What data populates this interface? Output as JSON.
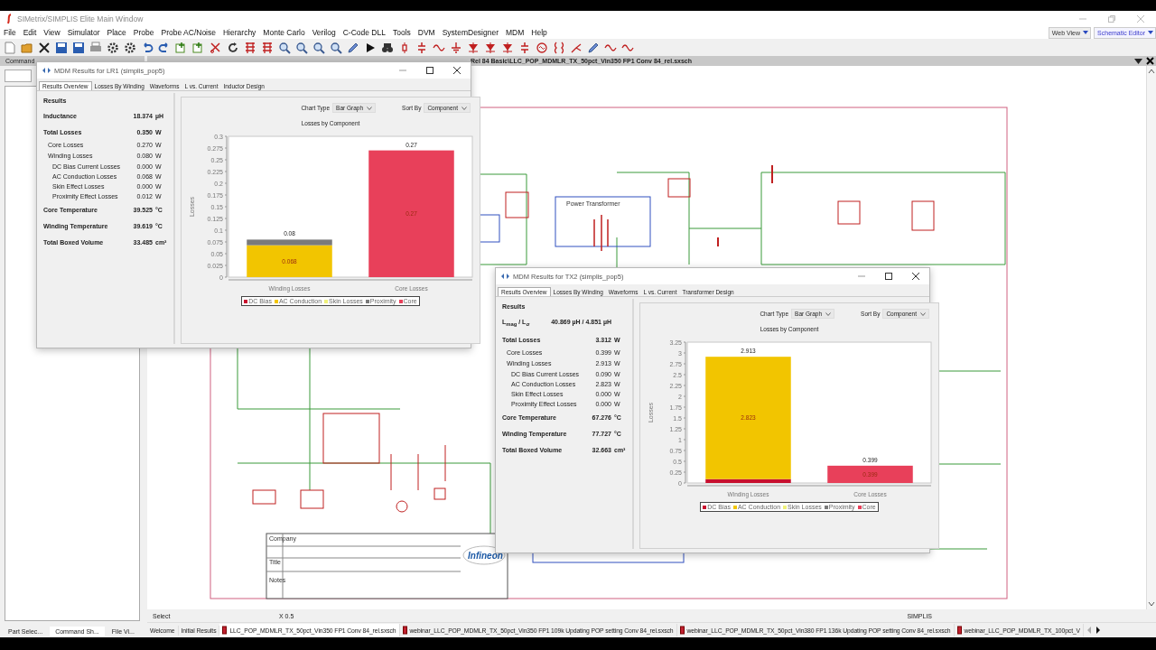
{
  "app": {
    "title": "SIMetrix/SIMPLIS Elite Main Window"
  },
  "menu": [
    "File",
    "Edit",
    "View",
    "Simulator",
    "Place",
    "Probe",
    "Probe AC/Noise",
    "Hierarchy",
    "Monte Carlo",
    "Verilog",
    "C-Code DLL",
    "Tools",
    "DVM",
    "SystemDesigner",
    "MDM",
    "Help"
  ],
  "view_selectors": [
    {
      "label": "Web View",
      "selected": false
    },
    {
      "label": "Schematic Editor",
      "selected": true
    }
  ],
  "left_panel": {
    "header": "Command",
    "tabs": [
      {
        "label": "Part Selec...",
        "selected": false
      },
      {
        "label": "Command Sh...",
        "selected": true
      },
      {
        "label": "File Vi...",
        "selected": false
      }
    ]
  },
  "schematic": {
    "title": "Rel 84 Basic\\LLC_POP_MDMLR_TX_50pct_Vin350 FP1 Conv 84_rel.sxsch",
    "labels": [
      {
        "kind": "block",
        "text": "Power Transformer"
      },
      {
        "kind": "logo",
        "text": "Infineon"
      },
      {
        "kind": "field",
        "text": "Company"
      },
      {
        "kind": "field",
        "text": "Title"
      },
      {
        "kind": "field",
        "text": "Notes"
      }
    ]
  },
  "status_bar": {
    "mode": "Select",
    "zoom": "X 0.5",
    "simulator": "SIMPLIS"
  },
  "document_tabs": [
    {
      "label": "Welcome",
      "kind": "plain",
      "selected": false
    },
    {
      "label": "Initial Results",
      "kind": "plain",
      "selected": false
    },
    {
      "label": "LLC_POP_MDMLR_TX_50pct_Vin350 FP1 Conv 84_rel.sxsch",
      "kind": "schematic",
      "selected": true
    },
    {
      "label": "webinar_LLC_POP_MDMLR_TX_50pct_Vin350 FP1 109k Updating POP setting Conv 84_rel.sxsch",
      "kind": "schematic",
      "selected": false
    },
    {
      "label": "webinar_LLC_POP_MDMLR_TX_50pct_Vin380 FP1 136k Updating POP setting Conv 84_rel.sxsch",
      "kind": "schematic",
      "selected": false
    },
    {
      "label": "webinar_LLC_POP_MDMLR_TX_100pct_V",
      "kind": "schematic",
      "selected": false
    }
  ],
  "mdm_windows": [
    {
      "title": "MDM Results for LR1 (simplis_pop5)",
      "tabs": [
        {
          "label": "Results Overview",
          "selected": true
        },
        {
          "label": "Losses By Winding",
          "selected": false
        },
        {
          "label": "Waveforms",
          "selected": false
        },
        {
          "label": "L vs. Current",
          "selected": false
        },
        {
          "label": "Inductor Design",
          "selected": false
        }
      ],
      "results_heading": "Results",
      "results": [
        {
          "label": "Inductance",
          "value": "18.374",
          "unit": "µH"
        },
        {
          "label": "Total Losses",
          "value": "0.350",
          "unit": "W",
          "children": [
            {
              "label": "Core Losses",
              "value": "0.270",
              "unit": "W"
            },
            {
              "label": "Winding Losses",
              "value": "0.080",
              "unit": "W",
              "children": [
                {
                  "label": "DC Bias Current Losses",
                  "value": "0.000",
                  "unit": "W"
                },
                {
                  "label": "AC Conduction Losses",
                  "value": "0.068",
                  "unit": "W"
                },
                {
                  "label": "Skin Effect Losses",
                  "value": "0.000",
                  "unit": "W"
                },
                {
                  "label": "Proximity Effect Losses",
                  "value": "0.012",
                  "unit": "W"
                }
              ]
            }
          ]
        },
        {
          "label": "Core Temperature",
          "value": "39.525",
          "unit": "°C"
        },
        {
          "label": "Winding Temperature",
          "value": "39.619",
          "unit": "°C"
        },
        {
          "label": "Total Boxed Volume",
          "value": "33.485",
          "unit": "cm³"
        }
      ],
      "chart_type": {
        "label": "Chart Type",
        "value": "Bar Graph"
      },
      "sort_by": {
        "label": "Sort By",
        "value": "Component"
      },
      "chart_data": {
        "type": "bar",
        "stacked": true,
        "title": "Losses by Component",
        "ylabel": "Losses",
        "categories": [
          "Winding Losses",
          "Core Losses"
        ],
        "series": [
          {
            "name": "DC Bias",
            "color": "#c8102e",
            "values": [
              0,
              0
            ]
          },
          {
            "name": "AC Conduction",
            "color": "#f2c500",
            "values": [
              0.068,
              0
            ]
          },
          {
            "name": "Skin Losses",
            "color": "#eef07a",
            "values": [
              0,
              0
            ]
          },
          {
            "name": "Proximity",
            "color": "#7a7a7a",
            "values": [
              0.012,
              0
            ]
          },
          {
            "name": "Core",
            "color": "#e8405a",
            "values": [
              0,
              0.27
            ]
          }
        ],
        "ylim": [
          0,
          0.3
        ],
        "yticks": [
          0,
          0.025,
          0.05,
          0.075,
          0.1,
          0.125,
          0.15,
          0.175,
          0.2,
          0.225,
          0.25,
          0.275,
          0.3
        ],
        "value_labels": [
          "0.08",
          "0.27"
        ],
        "legend": "bottom",
        "annotations": [
          "0.068",
          "0.27"
        ]
      }
    },
    {
      "title": "MDM Results for TX2 (simplis_pop5)",
      "tabs": [
        {
          "label": "Results Overview",
          "selected": true
        },
        {
          "label": "Losses By Winding",
          "selected": false
        },
        {
          "label": "Waveforms",
          "selected": false
        },
        {
          "label": "L vs. Current",
          "selected": false
        },
        {
          "label": "Transformer Design",
          "selected": false
        }
      ],
      "results_heading": "Results",
      "results": [
        {
          "label": "L$_{mag}$ / L$_{σ}$",
          "value": "40.869 µH / 4.851 µH"
        },
        {
          "label": "Total Losses",
          "value": "3.312",
          "unit": "W",
          "children": [
            {
              "label": "Core Losses",
              "value": "0.399",
              "unit": "W"
            },
            {
              "label": "Winding Losses",
              "value": "2.913",
              "unit": "W",
              "children": [
                {
                  "label": "DC Bias Current Losses",
                  "value": "0.090",
                  "unit": "W"
                },
                {
                  "label": "AC Conduction Losses",
                  "value": "2.823",
                  "unit": "W"
                },
                {
                  "label": "Skin Effect Losses",
                  "value": "0.000",
                  "unit": "W"
                },
                {
                  "label": "Proximity Effect Losses",
                  "value": "0.000",
                  "unit": "W"
                }
              ]
            }
          ]
        },
        {
          "label": "Core Temperature",
          "value": "67.276",
          "unit": "°C"
        },
        {
          "label": "Winding Temperature",
          "value": "77.727",
          "unit": "°C"
        },
        {
          "label": "Total Boxed Volume",
          "value": "32.663",
          "unit": "cm³"
        }
      ],
      "chart_type": {
        "label": "Chart Type",
        "value": "Bar Graph"
      },
      "sort_by": {
        "label": "Sort By",
        "value": "Component"
      },
      "chart_data": {
        "type": "bar",
        "stacked": true,
        "title": "Losses by Component",
        "ylabel": "Losses",
        "categories": [
          "Winding Losses",
          "Core Losses"
        ],
        "series": [
          {
            "name": "DC Bias",
            "color": "#c8102e",
            "values": [
              0.09,
              0
            ]
          },
          {
            "name": "AC Conduction",
            "color": "#f2c500",
            "values": [
              2.823,
              0
            ]
          },
          {
            "name": "Skin Losses",
            "color": "#eef07a",
            "values": [
              0,
              0
            ]
          },
          {
            "name": "Proximity",
            "color": "#7a7a7a",
            "values": [
              0,
              0
            ]
          },
          {
            "name": "Core",
            "color": "#e8405a",
            "values": [
              0,
              0.399
            ]
          }
        ],
        "ylim": [
          0,
          3.25
        ],
        "yticks": [
          0,
          0.25,
          0.5,
          0.75,
          1,
          1.25,
          1.5,
          1.75,
          2,
          2.25,
          2.5,
          2.75,
          3,
          3.25
        ],
        "value_labels": [
          "2.913",
          "0.399"
        ],
        "legend": "bottom",
        "annotations": [
          "2.823",
          "0.399"
        ]
      }
    }
  ]
}
